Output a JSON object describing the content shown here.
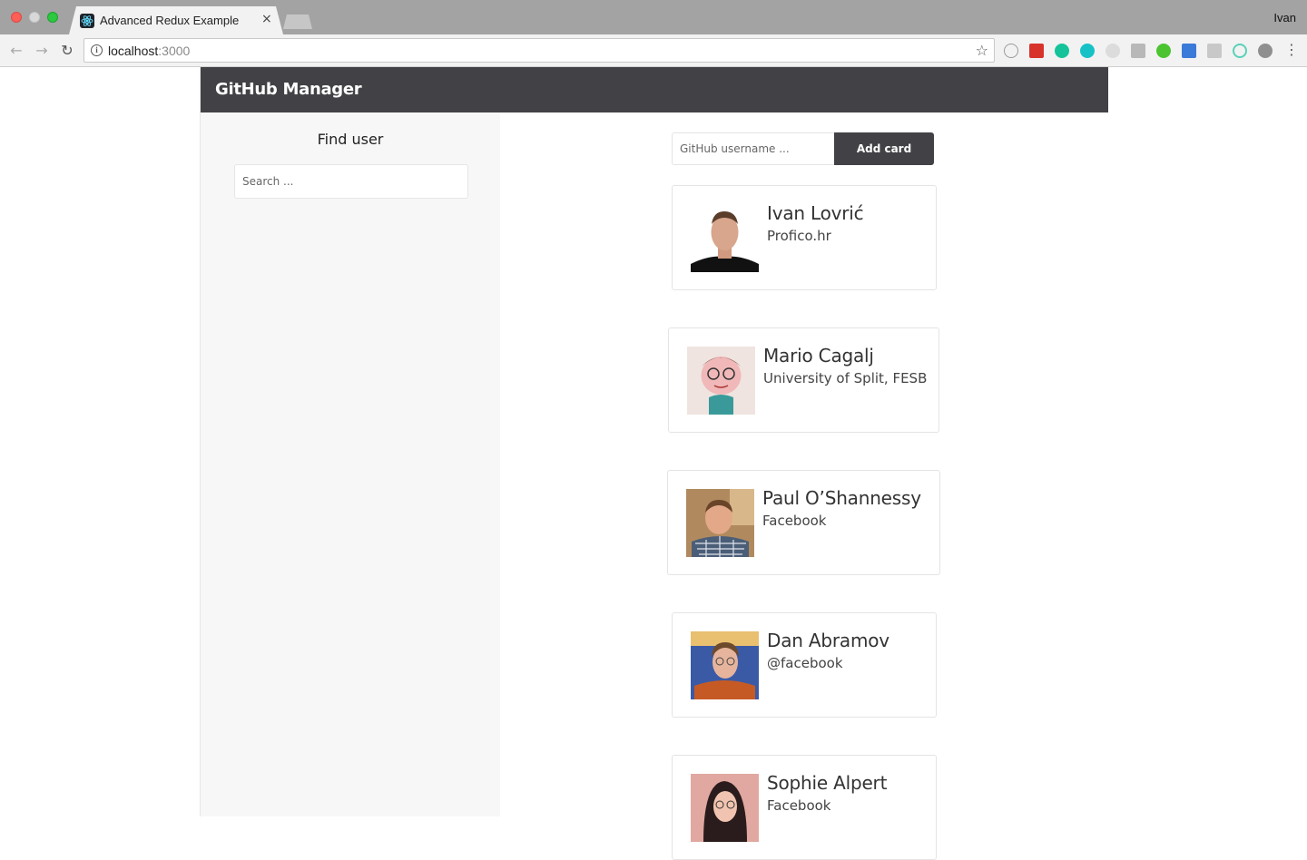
{
  "browser": {
    "tab_title": "Advanced Redux Example",
    "tab_close": "×",
    "profile_name": "Ivan",
    "url_host": "localhost",
    "url_port": ":3000",
    "nav": {
      "back": "←",
      "forward": "→",
      "reload": "↻"
    },
    "star": "☆",
    "menu": "⋮"
  },
  "app": {
    "title": "GitHub Manager"
  },
  "sidebar": {
    "heading": "Find user",
    "search_placeholder": "Search ..."
  },
  "main": {
    "username_placeholder": "GitHub username ...",
    "add_button_label": "Add card",
    "cards": [
      {
        "name": "Ivan Lovrić",
        "company": "Profico.hr"
      },
      {
        "name": "Mario Cagalj",
        "company": "University of Split, FESB"
      },
      {
        "name": "Paul O’Shannessy",
        "company": "Facebook"
      },
      {
        "name": "Dan Abramov",
        "company": "@facebook"
      },
      {
        "name": "Sophie Alpert",
        "company": "Facebook"
      }
    ]
  },
  "colors": {
    "header_bg": "#424246",
    "sidebar_bg": "#f7f7f7",
    "button_bg": "#424246",
    "card_border": "#e4e4e4"
  }
}
